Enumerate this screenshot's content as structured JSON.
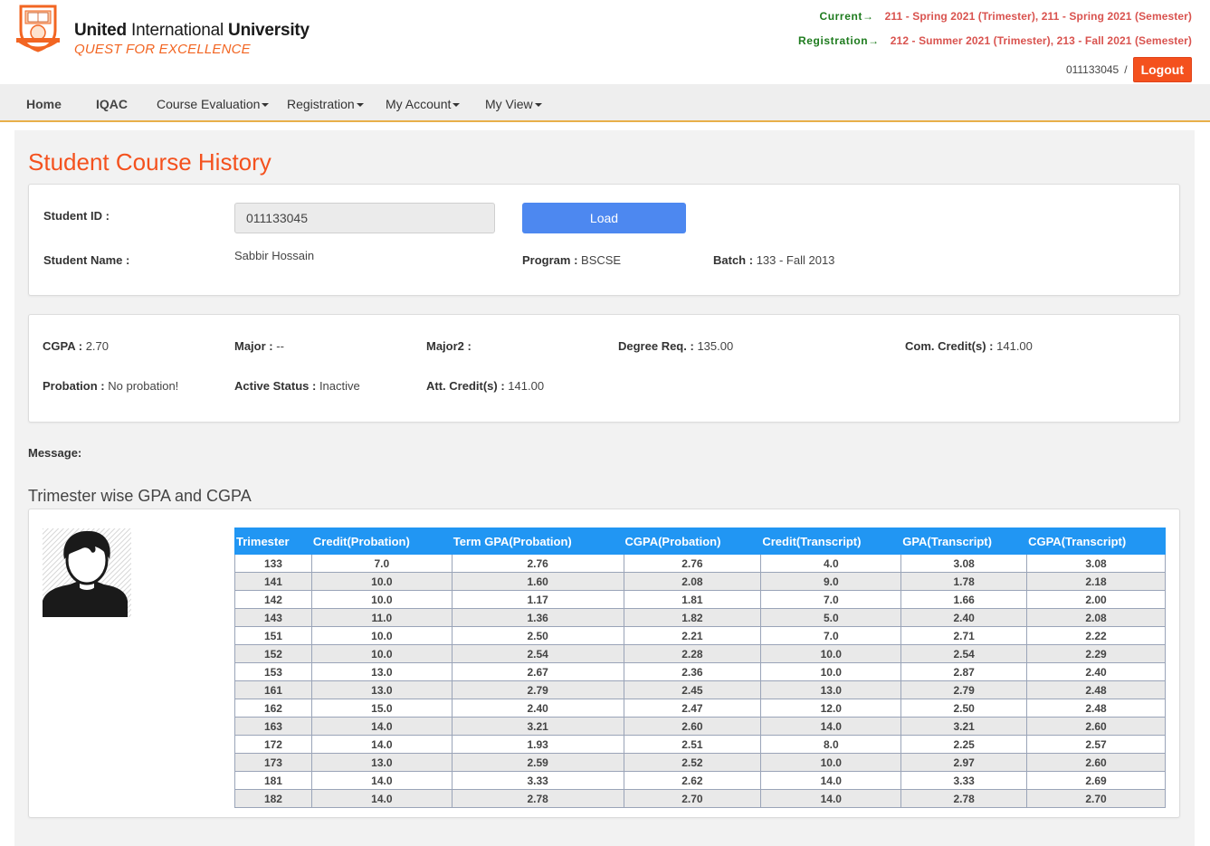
{
  "header": {
    "brand_name_bold": "United",
    "brand_name_rest": " International ",
    "brand_name_bold2": "University",
    "tagline": "QUEST FOR EXCELLENCE",
    "current_label": "Current→",
    "current_value": "211 - Spring 2021 (Trimester), 211 - Spring 2021 (Semester)",
    "registration_label": "Registration→",
    "registration_value": "212 - Summer 2021 (Trimester), 213 - Fall 2021 (Semester)",
    "user_id": "011133045",
    "separator": "/",
    "logout_label": "Logout"
  },
  "nav": {
    "home": "Home",
    "iqac": "IQAC",
    "course_evaluation": "Course Evaluation",
    "registration": "Registration",
    "my_account": "My Account",
    "my_view": "My View"
  },
  "page": {
    "title": "Student Course History",
    "student_id_label": "Student ID :",
    "student_id_value": "011133045",
    "load_label": "Load",
    "student_name_label": "Student Name :",
    "student_name_value": "Sabbir Hossain",
    "program_label": "Program :",
    "program_value": "BSCSE",
    "batch_label": "Batch :",
    "batch_value": "133 - Fall 2013",
    "cgpa_label": "CGPA :",
    "cgpa_value": "2.70",
    "major_label": "Major :",
    "major_value": "--",
    "major2_label": "Major2 :",
    "major2_value": "",
    "degree_req_label": "Degree Req. :",
    "degree_req_value": "135.00",
    "com_credit_label": "Com. Credit(s) :",
    "com_credit_value": "141.00",
    "probation_label": "Probation :",
    "probation_value": "No probation!",
    "active_status_label": "Active Status :",
    "active_status_value": "Inactive",
    "att_credit_label": "Att. Credit(s) :",
    "att_credit_value": "141.00",
    "message_label": "Message:",
    "section_title": "Trimester wise GPA and CGPA"
  },
  "colors": {
    "accent": "#f4511e",
    "table_header": "#2196f3",
    "button": "#4d88f0",
    "green_label": "#1e7b1e",
    "red_value": "#d9534f"
  },
  "table": {
    "headers": [
      "Trimester",
      "Credit(Probation)",
      "Term GPA(Probation)",
      "CGPA(Probation)",
      "Credit(Transcript)",
      "GPA(Transcript)",
      "CGPA(Transcript)"
    ],
    "rows": [
      [
        "133",
        "7.0",
        "2.76",
        "2.76",
        "4.0",
        "3.08",
        "3.08"
      ],
      [
        "141",
        "10.0",
        "1.60",
        "2.08",
        "9.0",
        "1.78",
        "2.18"
      ],
      [
        "142",
        "10.0",
        "1.17",
        "1.81",
        "7.0",
        "1.66",
        "2.00"
      ],
      [
        "143",
        "11.0",
        "1.36",
        "1.82",
        "5.0",
        "2.40",
        "2.08"
      ],
      [
        "151",
        "10.0",
        "2.50",
        "2.21",
        "7.0",
        "2.71",
        "2.22"
      ],
      [
        "152",
        "10.0",
        "2.54",
        "2.28",
        "10.0",
        "2.54",
        "2.29"
      ],
      [
        "153",
        "13.0",
        "2.67",
        "2.36",
        "10.0",
        "2.87",
        "2.40"
      ],
      [
        "161",
        "13.0",
        "2.79",
        "2.45",
        "13.0",
        "2.79",
        "2.48"
      ],
      [
        "162",
        "15.0",
        "2.40",
        "2.47",
        "12.0",
        "2.50",
        "2.48"
      ],
      [
        "163",
        "14.0",
        "3.21",
        "2.60",
        "14.0",
        "3.21",
        "2.60"
      ],
      [
        "172",
        "14.0",
        "1.93",
        "2.51",
        "8.0",
        "2.25",
        "2.57"
      ],
      [
        "173",
        "13.0",
        "2.59",
        "2.52",
        "10.0",
        "2.97",
        "2.60"
      ],
      [
        "181",
        "14.0",
        "3.33",
        "2.62",
        "14.0",
        "3.33",
        "2.69"
      ],
      [
        "182",
        "14.0",
        "2.78",
        "2.70",
        "14.0",
        "2.78",
        "2.70"
      ]
    ]
  }
}
